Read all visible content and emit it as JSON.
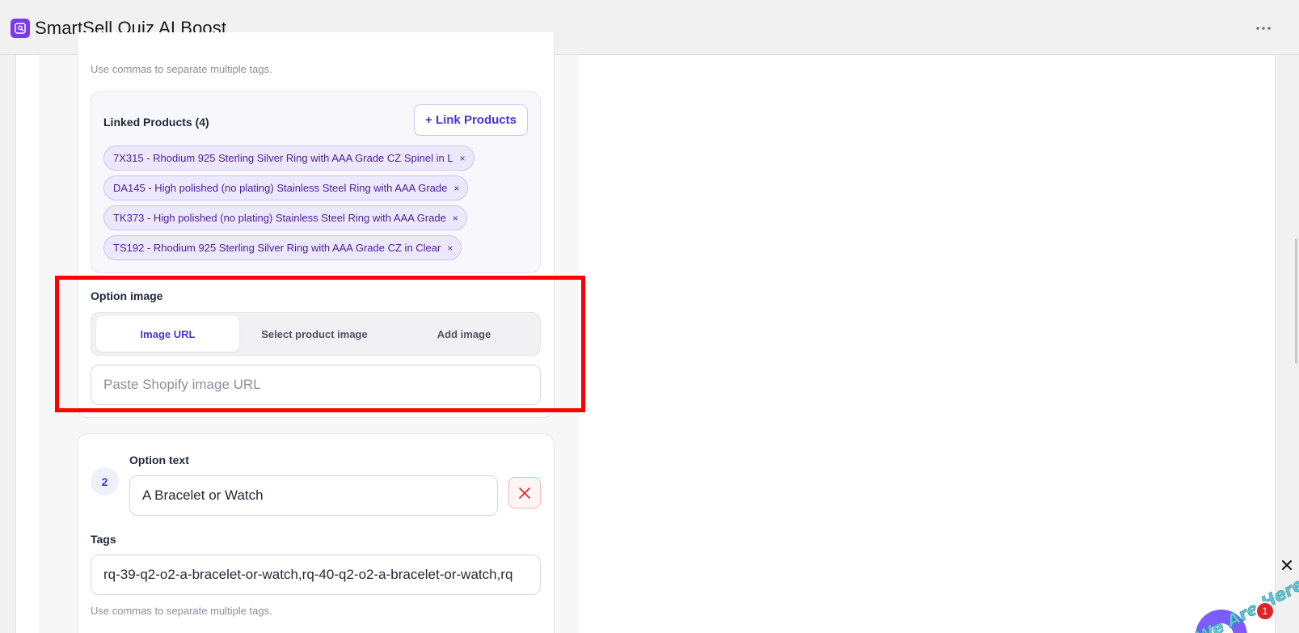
{
  "app": {
    "title": "SmartSell Quiz AI Boost"
  },
  "option1": {
    "tags_hint": "Use commas to separate multiple tags.",
    "linked_products": {
      "title": "Linked Products (4)",
      "link_button": "+ Link Products",
      "items": [
        "7X315 - Rhodium 925 Sterling Silver Ring with AAA Grade CZ Spinel in L",
        "DA145 - High polished (no plating) Stainless Steel Ring with AAA Grade",
        "TK373 - High polished (no plating) Stainless Steel Ring with AAA Grade",
        "TS192 - Rhodium 925 Sterling Silver Ring with AAA Grade CZ in Clear"
      ],
      "remove_glyph": "×"
    },
    "option_image": {
      "label": "Option image",
      "tabs": [
        "Image URL",
        "Select product image",
        "Add image"
      ],
      "active_tab": "Image URL",
      "url_placeholder": "Paste Shopify image URL",
      "url_value": ""
    }
  },
  "option2": {
    "number": "2",
    "text_label": "Option text",
    "text_value": "A Bracelet or Watch",
    "tags_label": "Tags",
    "tags_value": "rq-39-q2-o2-a-bracelet-or-watch,rq-40-q2-o2-a-bracelet-or-watch,rq",
    "tags_hint": "Use commas to separate multiple tags."
  },
  "widget": {
    "text": "We Are Here!",
    "notification_count": "1",
    "close_glyph": "✕"
  },
  "colors": {
    "accent": "#4338ca",
    "highlight": "#ff0000",
    "chip_bg": "#ece8fb",
    "app_icon": "#7c3aed"
  }
}
